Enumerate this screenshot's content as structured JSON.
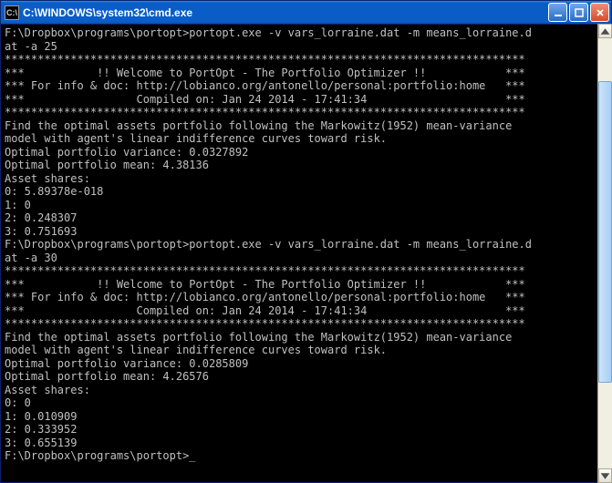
{
  "window": {
    "icon_glyph": "C:\\",
    "title": "C:\\WINDOWS\\system32\\cmd.exe"
  },
  "terminal": {
    "lines": [
      "F:\\Dropbox\\programs\\portopt>portopt.exe -v vars_lorraine.dat -m means_lorraine.d",
      "at -a 25",
      "",
      "*******************************************************************************",
      "***           !! Welcome to PortOpt - The Portfolio Optimizer !!            ***",
      "*** For info & doc: http://lobianco.org/antonello/personal:portfolio:home   ***",
      "***                 Compiled on: Jan 24 2014 - 17:41:34                     ***",
      "*******************************************************************************",
      "",
      "Find the optimal assets portfolio following the Markowitz(1952) mean-variance",
      "model with agent's linear indifference curves toward risk.",
      "",
      "Optimal portfolio variance: 0.0327892",
      "Optimal portfolio mean: 4.38136",
      "Asset shares:",
      "0: 5.89378e-018",
      "1: 0",
      "2: 0.248307",
      "3: 0.751693",
      "",
      "F:\\Dropbox\\programs\\portopt>portopt.exe -v vars_lorraine.dat -m means_lorraine.d",
      "at -a 30",
      "",
      "*******************************************************************************",
      "***           !! Welcome to PortOpt - The Portfolio Optimizer !!            ***",
      "*** For info & doc: http://lobianco.org/antonello/personal:portfolio:home   ***",
      "***                 Compiled on: Jan 24 2014 - 17:41:34                     ***",
      "*******************************************************************************",
      "",
      "Find the optimal assets portfolio following the Markowitz(1952) mean-variance",
      "model with agent's linear indifference curves toward risk.",
      "",
      "Optimal portfolio variance: 0.0285809",
      "Optimal portfolio mean: 4.26576",
      "Asset shares:",
      "0: 0",
      "1: 0.010909",
      "2: 0.333952",
      "3: 0.655139",
      "",
      "F:\\Dropbox\\programs\\portopt>"
    ],
    "cursor": "_"
  }
}
